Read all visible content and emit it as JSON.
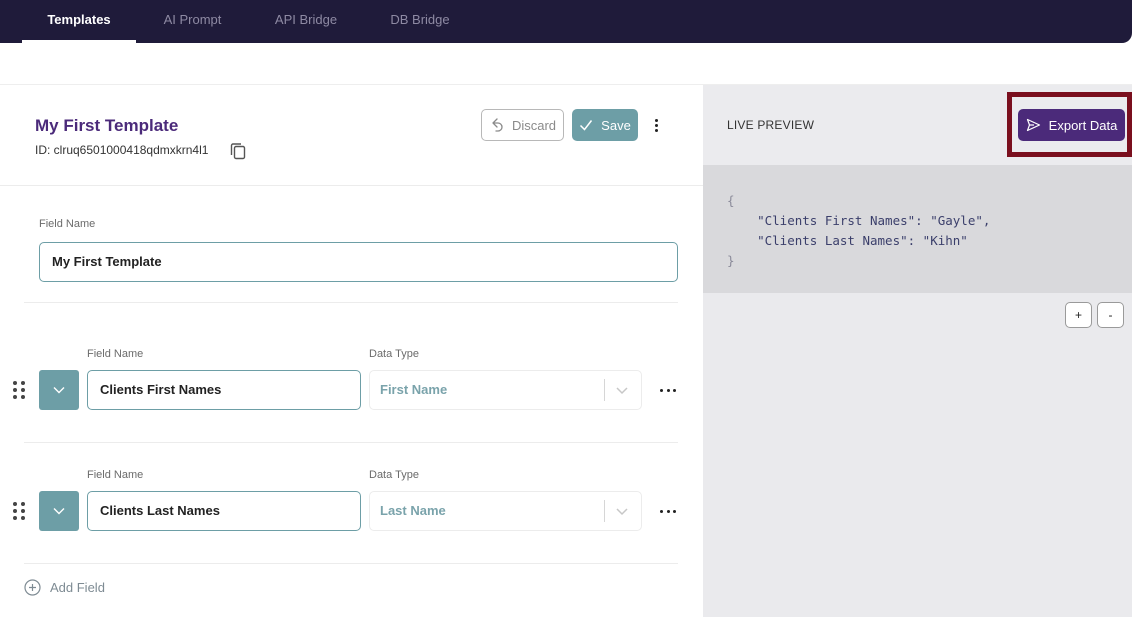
{
  "tabs": [
    {
      "label": "Templates",
      "active": true
    },
    {
      "label": "AI Prompt",
      "active": false
    },
    {
      "label": "API Bridge",
      "active": false
    },
    {
      "label": "DB Bridge",
      "active": false
    }
  ],
  "template": {
    "title": "My First Template",
    "id_text": "ID: clruq6501000418qdmxkrn4l1",
    "discard_label": "Discard",
    "save_label": "Save",
    "field_name_label": "Field Name",
    "field_name_value": "My First Template"
  },
  "fields": [
    {
      "name_label": "Field Name",
      "name_value": "Clients First Names",
      "type_label": "Data Type",
      "type_value": "First Name"
    },
    {
      "name_label": "Field Name",
      "name_value": "Clients Last Names",
      "type_label": "Data Type",
      "type_value": "Last Name"
    }
  ],
  "add_field_label": "Add Field",
  "preview": {
    "label": "LIVE PREVIEW",
    "export_label": "Export Data",
    "open_brace": "{",
    "line1": "    \"Clients First Names\": \"Gayle\",",
    "line2": "    \"Clients Last Names\": \"Kihn\"",
    "close_brace": "}",
    "zoom_in": "+",
    "zoom_out": "-"
  },
  "colors": {
    "topbar": "#1f1b3a",
    "accent_teal": "#6d9ea6",
    "brand_purple": "#4b2a7a",
    "highlight": "#7a0f1e"
  },
  "icons": [
    "copy-icon",
    "undo-icon",
    "check-icon",
    "kebab-icon",
    "drag-handle-icon",
    "chevron-down-icon",
    "more-horizontal-icon",
    "plus-circle-icon",
    "send-icon"
  ]
}
